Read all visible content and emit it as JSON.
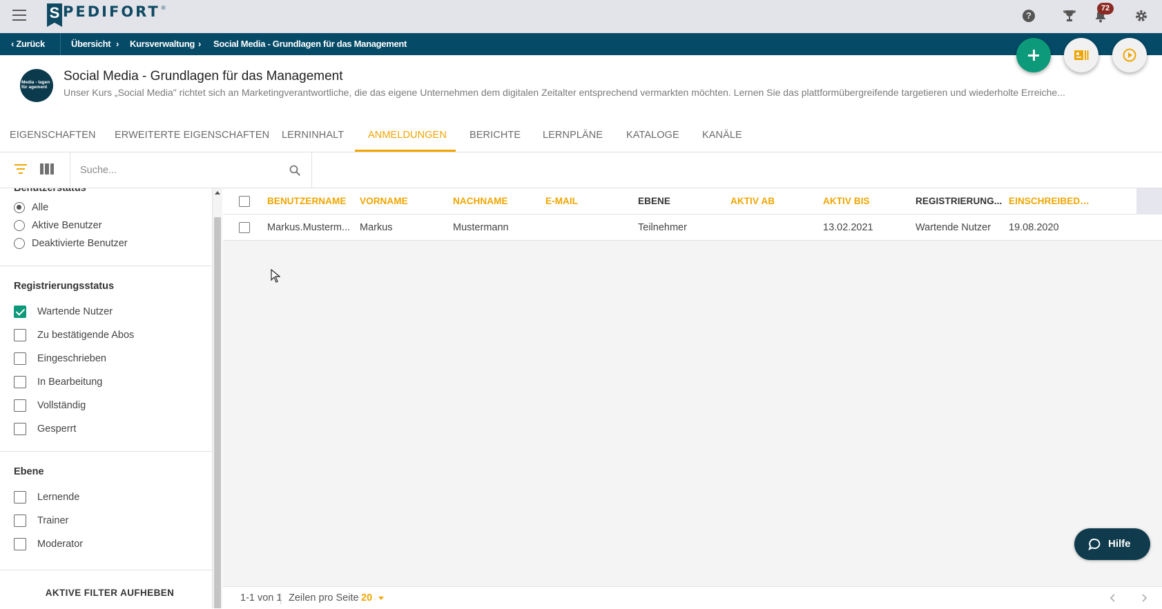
{
  "app": {
    "logo_text": "PEDIFORT",
    "logo_letter": "S",
    "logo_reg": "®"
  },
  "topbar": {
    "notification_count": "72"
  },
  "breadcrumb": {
    "back": "Zurück",
    "items": [
      "Übersicht",
      "Kursverwaltung",
      "Social Media - Grundlagen für das Management"
    ]
  },
  "course": {
    "logo_text": "Media - lagen für agement",
    "title": "Social Media - Grundlagen für das Management",
    "description": "Unser Kurs „Social Media\" richtet sich an Marketingverantwortliche, die das eigene Unternehmen dem digitalen Zeitalter entsprechend vermarkten möchten. Lernen Sie das plattformübergreifende targetieren und wiederholte Erreiche..."
  },
  "tabs": [
    {
      "label": "EIGENSCHAFTEN"
    },
    {
      "label": "ERWEITERTE EIGENSCHAFTEN"
    },
    {
      "label": "LERNINHALT"
    },
    {
      "label": "ANMELDUNGEN"
    },
    {
      "label": "BERICHTE"
    },
    {
      "label": "LERNPLÄNE"
    },
    {
      "label": "KATALOGE"
    },
    {
      "label": "KANÄLE"
    }
  ],
  "search": {
    "placeholder": "Suche..."
  },
  "filters": {
    "user_status_heading": "Benutzerstatus",
    "user_status": [
      {
        "label": "Alle",
        "selected": true
      },
      {
        "label": "Aktive Benutzer",
        "selected": false
      },
      {
        "label": "Deaktivierte Benutzer",
        "selected": false
      }
    ],
    "reg_heading": "Registrierungsstatus",
    "reg_status": [
      {
        "label": "Wartende Nutzer",
        "checked": true
      },
      {
        "label": "Zu bestätigende Abos",
        "checked": false
      },
      {
        "label": "Eingeschrieben",
        "checked": false
      },
      {
        "label": "In Bearbeitung",
        "checked": false
      },
      {
        "label": "Vollständig",
        "checked": false
      },
      {
        "label": "Gesperrt",
        "checked": false
      }
    ],
    "level_heading": "Ebene",
    "levels": [
      {
        "label": "Lernende",
        "checked": false
      },
      {
        "label": "Trainer",
        "checked": false
      },
      {
        "label": "Moderator",
        "checked": false
      }
    ],
    "clear_label": "AKTIVE FILTER AUFHEBEN"
  },
  "table": {
    "columns": [
      "BENUTZERNAME",
      "VORNAME",
      "NACHNAME",
      "E-MAIL",
      "EBENE",
      "AKTIV AB",
      "AKTIV BIS",
      "REGISTRIERUNG...",
      "EINSCHREIBEDA..."
    ],
    "rows": [
      [
        "Markus.Musterm...",
        "Markus",
        "Mustermann",
        "",
        "Teilnehmer",
        "",
        "13.02.2021",
        "Wartende Nutzer",
        "19.08.2020"
      ]
    ]
  },
  "pager": {
    "range": "1-1 von 1",
    "rows_label": "Zeilen pro Seite",
    "rows_value": "20"
  },
  "help_button": {
    "label": "Hilfe"
  },
  "colors": {
    "accent": "#f0a500",
    "brand": "#054a67",
    "green": "#0d9a7a"
  }
}
